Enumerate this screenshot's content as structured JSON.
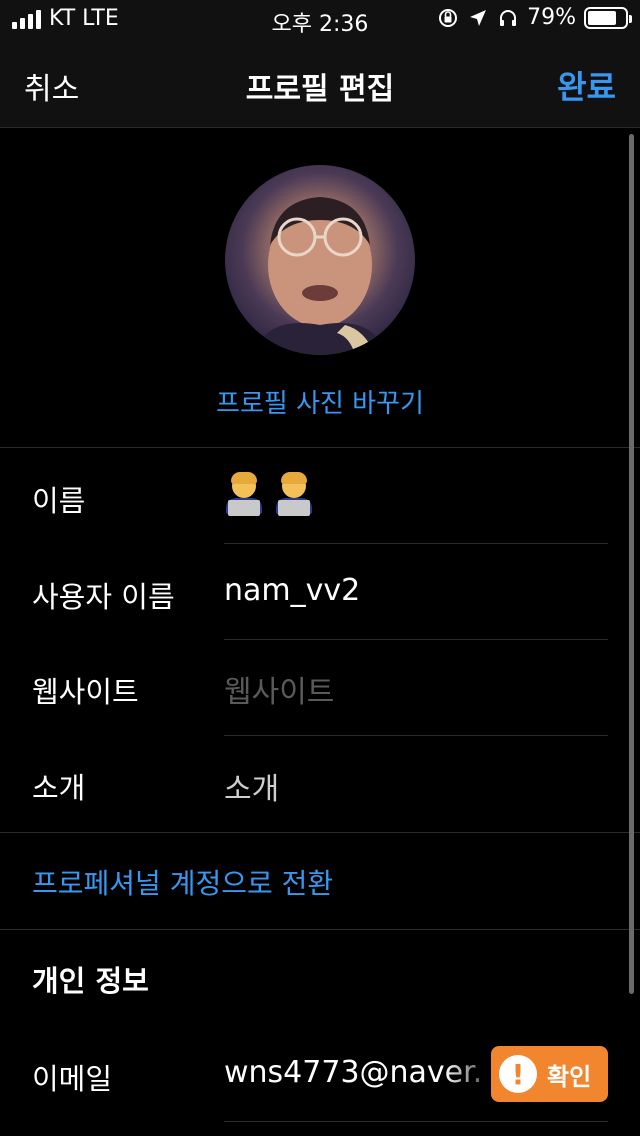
{
  "status": {
    "carrier": "KT LTE",
    "time": "오후 2:36",
    "battery": "79%",
    "battery_level": 0.79,
    "icons": [
      "orientation-lock-icon",
      "location-arrow-icon",
      "headphones-icon"
    ]
  },
  "nav": {
    "cancel": "취소",
    "title": "프로필 편집",
    "done": "완료"
  },
  "profile": {
    "change_photo": "프로필 사진 바꾸기"
  },
  "fields": {
    "name_label": "이름",
    "name_value_icon": "technologist-emoji",
    "username_label": "사용자 이름",
    "username_value": "nam_vv2",
    "website_label": "웹사이트",
    "website_placeholder": "웹사이트",
    "bio_label": "소개",
    "bio_placeholder": "소개"
  },
  "professional_switch": "프로페셔널 계정으로 전환",
  "private_info": {
    "title": "개인 정보",
    "email_label": "이메일",
    "email_value": "wns4773@naver.",
    "confirm_label": "확인"
  },
  "colors": {
    "accent": "#3897f0",
    "warning": "#f2862e",
    "background": "#000000"
  }
}
